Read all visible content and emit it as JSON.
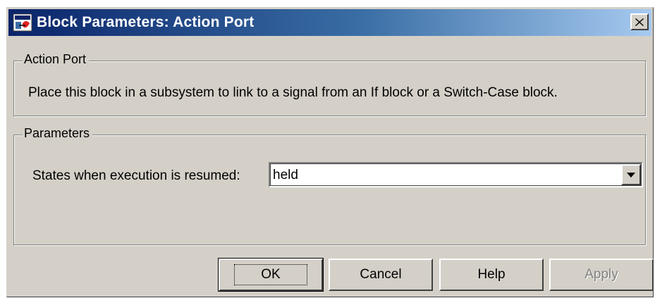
{
  "window": {
    "title": "Block Parameters: Action Port",
    "close_glyph": "✕"
  },
  "action_group": {
    "legend": "Action Port",
    "description": "Place this block in a subsystem to link to a signal from an If block or a Switch-Case block."
  },
  "parameters_group": {
    "legend": "Parameters",
    "states_label": "States when execution is resumed:",
    "states_value": "held"
  },
  "buttons": {
    "ok": "OK",
    "cancel": "Cancel",
    "help": "Help",
    "apply": "Apply"
  },
  "icons": {
    "app": "simulink-block-icon",
    "close": "close-icon",
    "dropdown": "chevron-down-icon"
  },
  "colors": {
    "title_start": "#0a246a",
    "title_end": "#a6caf0",
    "face": "#d4d0c8"
  }
}
